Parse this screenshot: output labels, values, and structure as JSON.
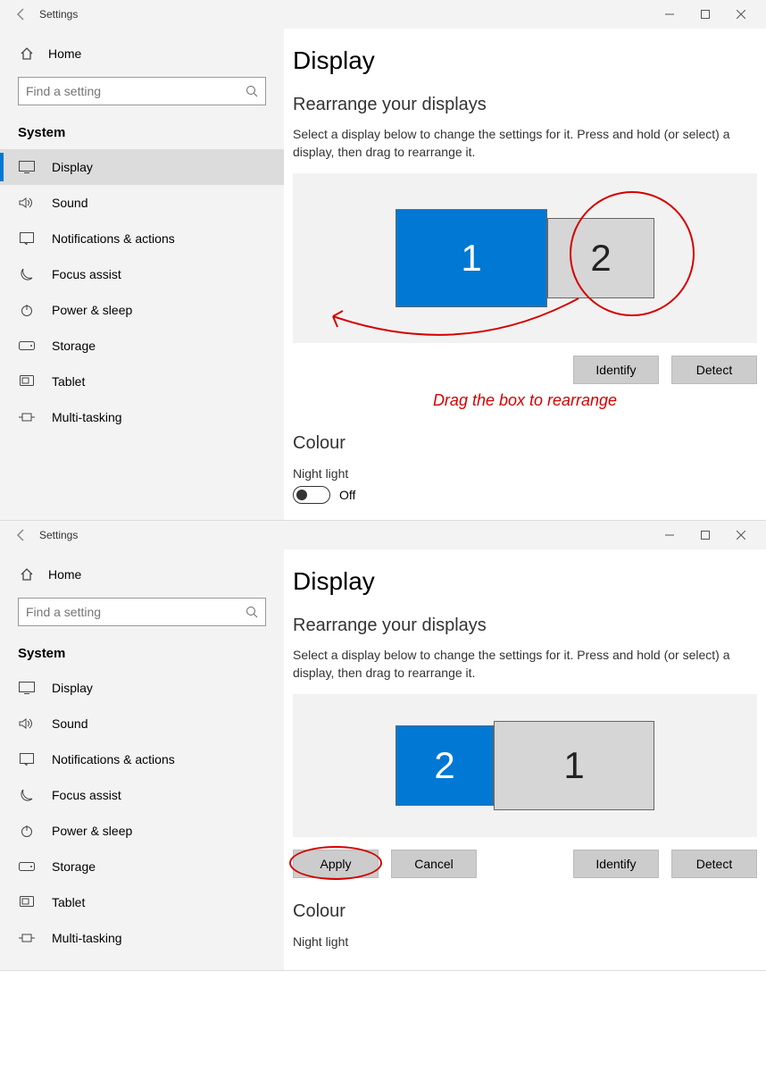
{
  "titlebar": {
    "title": "Settings"
  },
  "home": {
    "label": "Home"
  },
  "search": {
    "placeholder": "Find a setting"
  },
  "section": {
    "label": "System"
  },
  "nav": [
    {
      "label": "Display",
      "icon": "display-icon",
      "selected": true
    },
    {
      "label": "Sound",
      "icon": "sound-icon"
    },
    {
      "label": "Notifications & actions",
      "icon": "notifications-icon"
    },
    {
      "label": "Focus assist",
      "icon": "focus-icon"
    },
    {
      "label": "Power & sleep",
      "icon": "power-icon"
    },
    {
      "label": "Storage",
      "icon": "storage-icon"
    },
    {
      "label": "Tablet",
      "icon": "tablet-icon"
    },
    {
      "label": "Multi-tasking",
      "icon": "multitask-icon"
    }
  ],
  "page": {
    "title": "Display",
    "rearrange_title": "Rearrange your displays",
    "rearrange_desc": "Select a display below to change the settings for it. Press and hold (or select) a display, then drag to rearrange it.",
    "identify": "Identify",
    "detect": "Detect",
    "apply": "Apply",
    "cancel": "Cancel",
    "colour_title": "Colour",
    "night_light_label": "Night light",
    "toggle_off": "Off"
  },
  "top_monitors": {
    "left": "1",
    "right": "2"
  },
  "bottom_monitors": {
    "left": "2",
    "right": "1"
  },
  "annotation": {
    "drag_text": "Drag the box to rearrange"
  }
}
